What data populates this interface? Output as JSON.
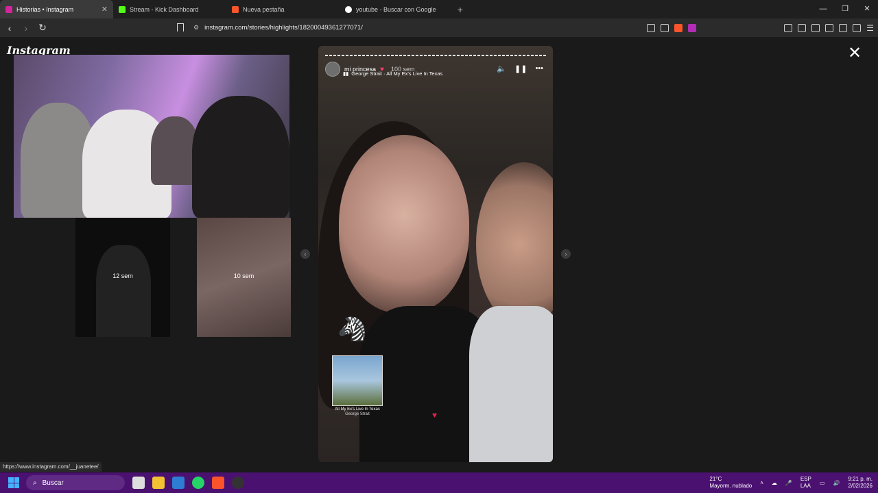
{
  "tabs": [
    {
      "label": "Historias • Instagram",
      "active": true,
      "color": "#d6249f"
    },
    {
      "label": "Stream - Kick Dashboard",
      "active": false,
      "color": "#53fc18"
    },
    {
      "label": "Nueva pestaña",
      "active": false,
      "color": "#fb542b"
    },
    {
      "label": "youtube - Buscar con Google",
      "active": false,
      "color": "#ffffff"
    }
  ],
  "url": "instagram.com/stories/highlights/18200049361277071/",
  "page": {
    "logo": "Instagram",
    "thumb_small_1_label": "12 sem",
    "thumb_small_2_label": "10 sem"
  },
  "story": {
    "username": "mi princesa",
    "time": "100 sem",
    "song": "George Strait · All My Ex's Live In Texas",
    "album_title": "All My Ex's Live In Texas",
    "album_artist": "George Strait"
  },
  "status_url": "https://www.instagram.com/__juanetee/",
  "taskbar": {
    "search_placeholder": "Buscar",
    "temp": "21°C",
    "weather": "Mayorm. nublado",
    "lang1": "ESP",
    "lang2": "LAA",
    "time": "9:21 p. m.",
    "date": "2/02/2026"
  }
}
